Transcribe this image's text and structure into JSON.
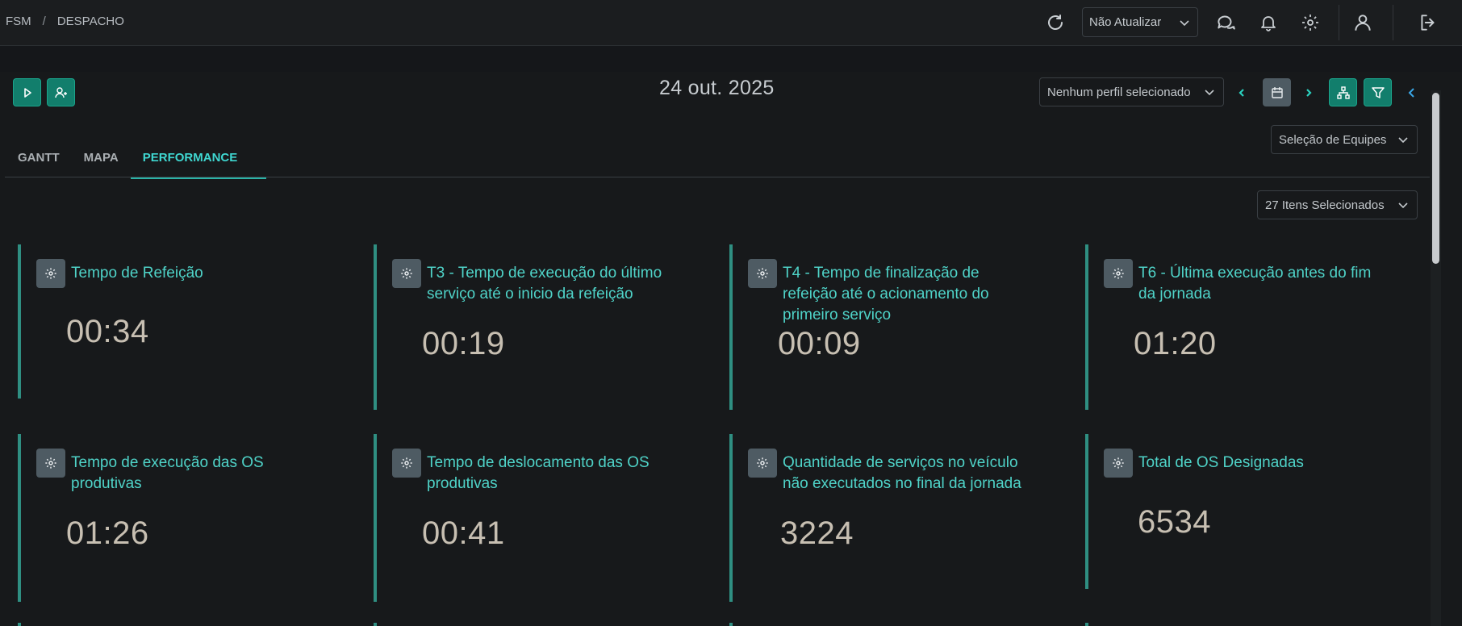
{
  "breadcrumb": {
    "root": "FSM",
    "separator": "/",
    "current": "DESPACHO"
  },
  "topbar": {
    "refresh_select": "Não Atualizar",
    "icons": [
      "refresh-icon",
      "chat-icon",
      "bell-icon",
      "gear-icon",
      "user-icon",
      "logout-icon"
    ]
  },
  "toolbar": {
    "date": "24 out. 2025",
    "profile_select": "Nenhum perfil selecionado",
    "team_select": "Seleção de Equipes",
    "items_select": "27 Itens Selecionados"
  },
  "tabs": [
    {
      "label": "GANTT",
      "active": false
    },
    {
      "label": "MAPA",
      "active": false
    },
    {
      "label": "PERFORMANCE",
      "active": true
    }
  ],
  "cards": [
    {
      "title": "Tempo de Refeição",
      "value": "00:34"
    },
    {
      "title": "T3 - Tempo de execução do último serviço até o inicio da refeição",
      "value": "00:19"
    },
    {
      "title": "T4 - Tempo de finalização de refeição até o acionamento do primeiro serviço",
      "value": "00:09"
    },
    {
      "title": "T6 - Última execução antes do fim da jornada",
      "value": "01:20"
    },
    {
      "title": "Tempo de execução das OS produtivas",
      "value": "01:26"
    },
    {
      "title": "Tempo de deslocamento das OS produtivas",
      "value": "00:41"
    },
    {
      "title": "Quantidade de serviços no veículo não executados no final da jornada",
      "value": "3224"
    },
    {
      "title": "Total de OS Designadas",
      "value": "6534"
    }
  ],
  "colors": {
    "accent": "#127e6c",
    "tab_active": "#3fd7d1",
    "card_title": "#4fd3c8",
    "card_border": "#2f8f82"
  }
}
